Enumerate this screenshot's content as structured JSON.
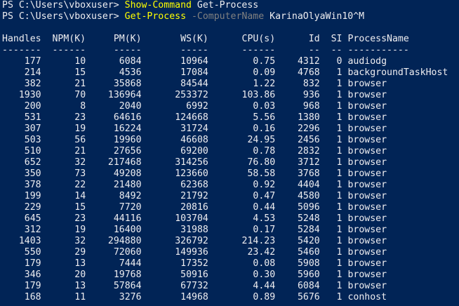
{
  "prompt1": {
    "prompt": "PS C:\\Users\\vboxuser> ",
    "cmdlet": "Show-Command",
    "rest": " Get-Process"
  },
  "prompt2": {
    "prompt": "PS C:\\Users\\vboxuser> ",
    "cmdlet": "Get-Process",
    "space1": " ",
    "param": "-ComputerName",
    "rest": " KarinaOlyaWin10^M"
  },
  "columns": [
    "Handles",
    "NPM(K)",
    "PM(K)",
    "WS(K)",
    "CPU(s)",
    "Id",
    "SI",
    "ProcessName"
  ],
  "separators": [
    "-------",
    "------",
    "-----",
    "-----",
    "------",
    "--",
    "--",
    "-----------"
  ],
  "rows": [
    [
      "177",
      "10",
      "6084",
      "10964",
      "0.75",
      "4312",
      "0",
      "audiodg"
    ],
    [
      "214",
      "15",
      "4536",
      "17084",
      "0.09",
      "4768",
      "1",
      "backgroundTaskHost"
    ],
    [
      "382",
      "21",
      "35868",
      "84544",
      "1.22",
      "832",
      "1",
      "browser"
    ],
    [
      "1930",
      "70",
      "136964",
      "253372",
      "103.86",
      "936",
      "1",
      "browser"
    ],
    [
      "200",
      "8",
      "2040",
      "6992",
      "0.03",
      "968",
      "1",
      "browser"
    ],
    [
      "531",
      "23",
      "64616",
      "124668",
      "5.56",
      "1380",
      "1",
      "browser"
    ],
    [
      "307",
      "19",
      "16224",
      "31724",
      "0.16",
      "2296",
      "1",
      "browser"
    ],
    [
      "503",
      "56",
      "19960",
      "46608",
      "24.95",
      "2456",
      "1",
      "browser"
    ],
    [
      "510",
      "21",
      "27656",
      "69200",
      "0.78",
      "2832",
      "1",
      "browser"
    ],
    [
      "652",
      "32",
      "217468",
      "314256",
      "76.80",
      "3712",
      "1",
      "browser"
    ],
    [
      "350",
      "73",
      "49208",
      "123660",
      "58.58",
      "3768",
      "1",
      "browser"
    ],
    [
      "378",
      "22",
      "21480",
      "62368",
      "0.92",
      "4404",
      "1",
      "browser"
    ],
    [
      "199",
      "14",
      "8492",
      "21792",
      "0.47",
      "4580",
      "1",
      "browser"
    ],
    [
      "229",
      "15",
      "7720",
      "20816",
      "0.44",
      "5096",
      "1",
      "browser"
    ],
    [
      "645",
      "23",
      "44116",
      "103704",
      "4.53",
      "5248",
      "1",
      "browser"
    ],
    [
      "312",
      "19",
      "16400",
      "31988",
      "0.17",
      "5284",
      "1",
      "browser"
    ],
    [
      "1403",
      "32",
      "294880",
      "326792",
      "214.23",
      "5420",
      "1",
      "browser"
    ],
    [
      "550",
      "29",
      "72060",
      "149936",
      "23.42",
      "5460",
      "1",
      "browser"
    ],
    [
      "179",
      "13",
      "7444",
      "17352",
      "0.08",
      "5908",
      "1",
      "browser"
    ],
    [
      "346",
      "20",
      "19768",
      "50916",
      "0.30",
      "5960",
      "1",
      "browser"
    ],
    [
      "179",
      "13",
      "57864",
      "67732",
      "4.44",
      "6084",
      "1",
      "browser"
    ],
    [
      "168",
      "11",
      "3276",
      "14968",
      "0.89",
      "5676",
      "1",
      "conhost"
    ]
  ],
  "colors": {
    "background": "#012456",
    "text": "#eeedf0",
    "cmdlet": "#ffff00",
    "parameter": "#808080"
  }
}
